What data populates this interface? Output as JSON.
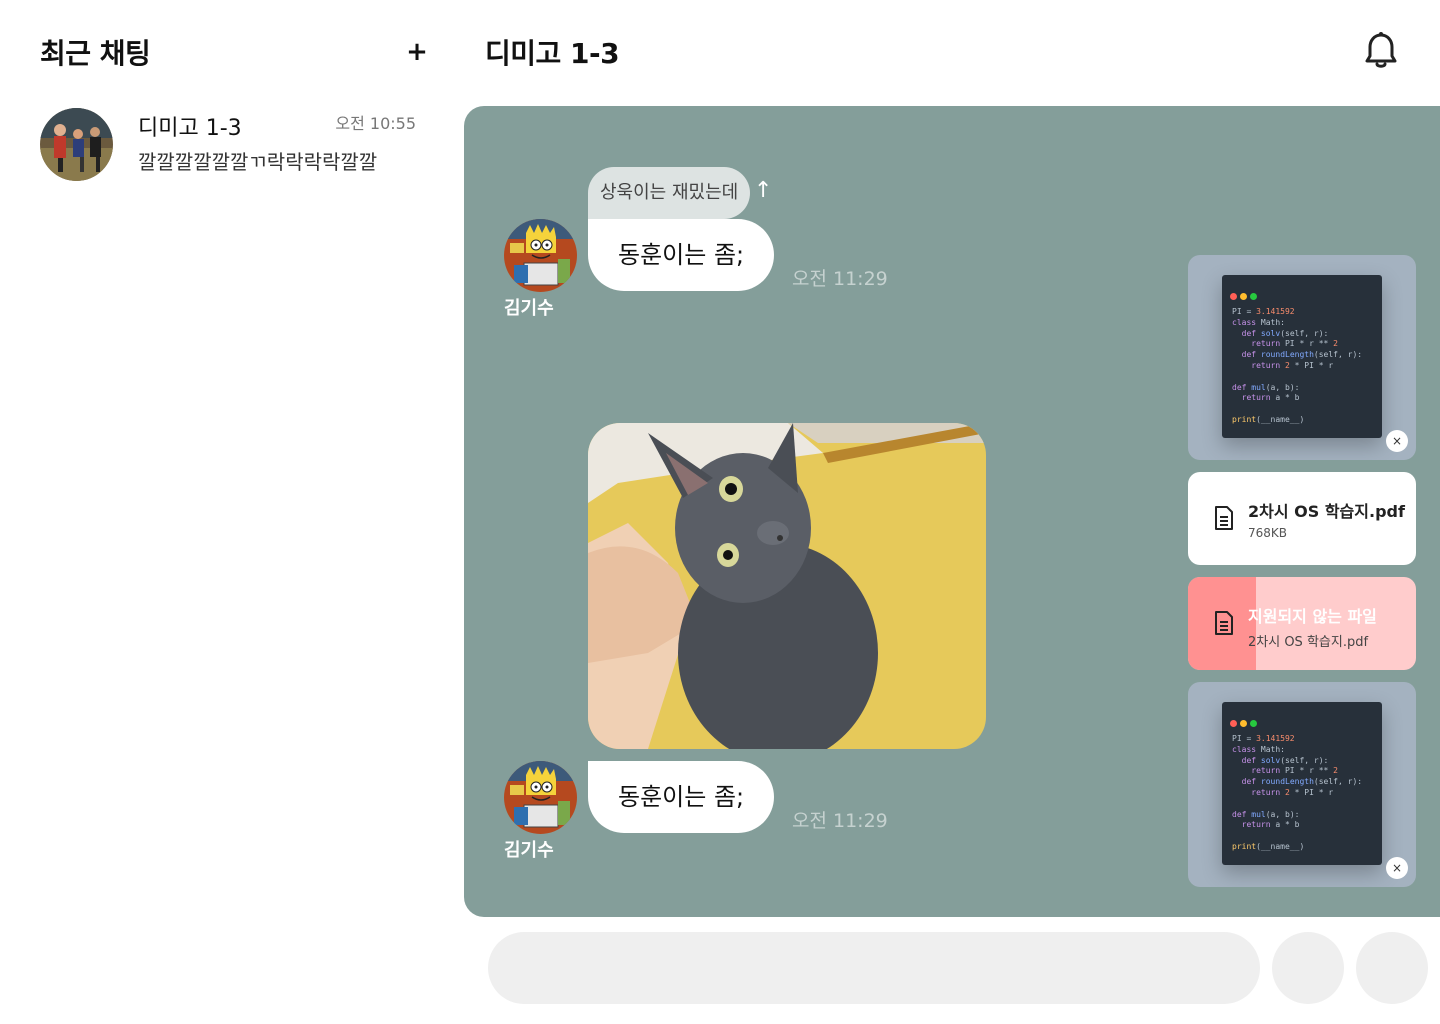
{
  "sidebar": {
    "title": "최근 채팅",
    "add_label": "+",
    "chats": [
      {
        "name": "디미고 1-3",
        "time": "오전 10:55",
        "preview": "깔깔깔깔깔깔ㄲ락락락락깔깔"
      }
    ]
  },
  "header": {
    "room_title": "디미고 1-3",
    "bell_icon": "bell-icon"
  },
  "messages": {
    "reply_preview": "상욱이는 재밌는데",
    "reply_arrow": "↑",
    "items": [
      {
        "sender": "김기수",
        "text": "동훈이는 좀;",
        "time": "오전 11:29"
      },
      {
        "sender": "김기수",
        "text": "동훈이는 좀;",
        "time": "오전 11:29"
      }
    ],
    "photo_icon": "cat-photo"
  },
  "attachments": {
    "file": {
      "name": "2차시 OS 학습지.pdf",
      "size": "768KB"
    },
    "error": {
      "title": "지원되지 않는 파일",
      "name": "2차시 OS 학습지.pdf",
      "progress": 0.3
    },
    "close_label": "×"
  },
  "composer": {
    "placeholder": ""
  },
  "colors": {
    "panel": "#849e9a",
    "error_bg": "#ffcccc",
    "error_bar": "#ff9191"
  }
}
